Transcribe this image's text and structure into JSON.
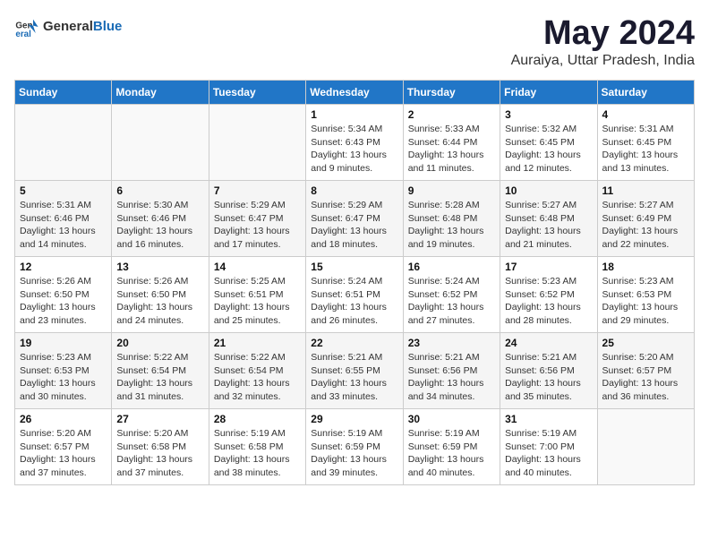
{
  "header": {
    "logo_general": "General",
    "logo_blue": "Blue",
    "title": "May 2024",
    "subtitle": "Auraiya, Uttar Pradesh, India"
  },
  "calendar": {
    "days_of_week": [
      "Sunday",
      "Monday",
      "Tuesday",
      "Wednesday",
      "Thursday",
      "Friday",
      "Saturday"
    ],
    "weeks": [
      [
        {
          "day": "",
          "info": ""
        },
        {
          "day": "",
          "info": ""
        },
        {
          "day": "",
          "info": ""
        },
        {
          "day": "1",
          "info": "Sunrise: 5:34 AM\nSunset: 6:43 PM\nDaylight: 13 hours\nand 9 minutes."
        },
        {
          "day": "2",
          "info": "Sunrise: 5:33 AM\nSunset: 6:44 PM\nDaylight: 13 hours\nand 11 minutes."
        },
        {
          "day": "3",
          "info": "Sunrise: 5:32 AM\nSunset: 6:45 PM\nDaylight: 13 hours\nand 12 minutes."
        },
        {
          "day": "4",
          "info": "Sunrise: 5:31 AM\nSunset: 6:45 PM\nDaylight: 13 hours\nand 13 minutes."
        }
      ],
      [
        {
          "day": "5",
          "info": "Sunrise: 5:31 AM\nSunset: 6:46 PM\nDaylight: 13 hours\nand 14 minutes."
        },
        {
          "day": "6",
          "info": "Sunrise: 5:30 AM\nSunset: 6:46 PM\nDaylight: 13 hours\nand 16 minutes."
        },
        {
          "day": "7",
          "info": "Sunrise: 5:29 AM\nSunset: 6:47 PM\nDaylight: 13 hours\nand 17 minutes."
        },
        {
          "day": "8",
          "info": "Sunrise: 5:29 AM\nSunset: 6:47 PM\nDaylight: 13 hours\nand 18 minutes."
        },
        {
          "day": "9",
          "info": "Sunrise: 5:28 AM\nSunset: 6:48 PM\nDaylight: 13 hours\nand 19 minutes."
        },
        {
          "day": "10",
          "info": "Sunrise: 5:27 AM\nSunset: 6:48 PM\nDaylight: 13 hours\nand 21 minutes."
        },
        {
          "day": "11",
          "info": "Sunrise: 5:27 AM\nSunset: 6:49 PM\nDaylight: 13 hours\nand 22 minutes."
        }
      ],
      [
        {
          "day": "12",
          "info": "Sunrise: 5:26 AM\nSunset: 6:50 PM\nDaylight: 13 hours\nand 23 minutes."
        },
        {
          "day": "13",
          "info": "Sunrise: 5:26 AM\nSunset: 6:50 PM\nDaylight: 13 hours\nand 24 minutes."
        },
        {
          "day": "14",
          "info": "Sunrise: 5:25 AM\nSunset: 6:51 PM\nDaylight: 13 hours\nand 25 minutes."
        },
        {
          "day": "15",
          "info": "Sunrise: 5:24 AM\nSunset: 6:51 PM\nDaylight: 13 hours\nand 26 minutes."
        },
        {
          "day": "16",
          "info": "Sunrise: 5:24 AM\nSunset: 6:52 PM\nDaylight: 13 hours\nand 27 minutes."
        },
        {
          "day": "17",
          "info": "Sunrise: 5:23 AM\nSunset: 6:52 PM\nDaylight: 13 hours\nand 28 minutes."
        },
        {
          "day": "18",
          "info": "Sunrise: 5:23 AM\nSunset: 6:53 PM\nDaylight: 13 hours\nand 29 minutes."
        }
      ],
      [
        {
          "day": "19",
          "info": "Sunrise: 5:23 AM\nSunset: 6:53 PM\nDaylight: 13 hours\nand 30 minutes."
        },
        {
          "day": "20",
          "info": "Sunrise: 5:22 AM\nSunset: 6:54 PM\nDaylight: 13 hours\nand 31 minutes."
        },
        {
          "day": "21",
          "info": "Sunrise: 5:22 AM\nSunset: 6:54 PM\nDaylight: 13 hours\nand 32 minutes."
        },
        {
          "day": "22",
          "info": "Sunrise: 5:21 AM\nSunset: 6:55 PM\nDaylight: 13 hours\nand 33 minutes."
        },
        {
          "day": "23",
          "info": "Sunrise: 5:21 AM\nSunset: 6:56 PM\nDaylight: 13 hours\nand 34 minutes."
        },
        {
          "day": "24",
          "info": "Sunrise: 5:21 AM\nSunset: 6:56 PM\nDaylight: 13 hours\nand 35 minutes."
        },
        {
          "day": "25",
          "info": "Sunrise: 5:20 AM\nSunset: 6:57 PM\nDaylight: 13 hours\nand 36 minutes."
        }
      ],
      [
        {
          "day": "26",
          "info": "Sunrise: 5:20 AM\nSunset: 6:57 PM\nDaylight: 13 hours\nand 37 minutes."
        },
        {
          "day": "27",
          "info": "Sunrise: 5:20 AM\nSunset: 6:58 PM\nDaylight: 13 hours\nand 37 minutes."
        },
        {
          "day": "28",
          "info": "Sunrise: 5:19 AM\nSunset: 6:58 PM\nDaylight: 13 hours\nand 38 minutes."
        },
        {
          "day": "29",
          "info": "Sunrise: 5:19 AM\nSunset: 6:59 PM\nDaylight: 13 hours\nand 39 minutes."
        },
        {
          "day": "30",
          "info": "Sunrise: 5:19 AM\nSunset: 6:59 PM\nDaylight: 13 hours\nand 40 minutes."
        },
        {
          "day": "31",
          "info": "Sunrise: 5:19 AM\nSunset: 7:00 PM\nDaylight: 13 hours\nand 40 minutes."
        },
        {
          "day": "",
          "info": ""
        }
      ]
    ]
  }
}
